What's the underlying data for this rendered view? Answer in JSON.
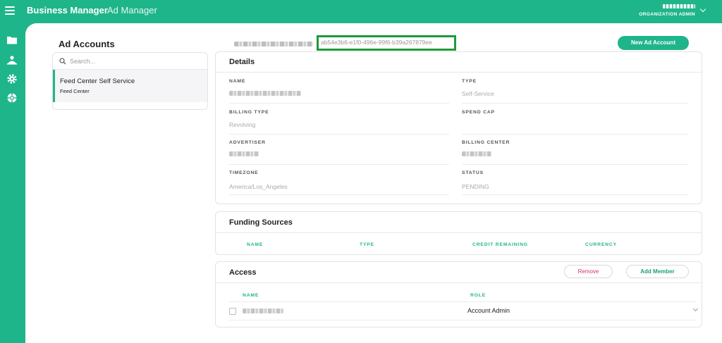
{
  "topbar": {
    "brand": "Business Manager",
    "nav_ad_manager": "Ad Manager",
    "user_role": "ORGANIZATION ADMIN"
  },
  "sidebar": {
    "icons": [
      "folder-icon",
      "members-icon",
      "gear-icon",
      "support-icon"
    ]
  },
  "accounts": {
    "title": "Ad Accounts",
    "search_placeholder": "Search...",
    "items": [
      {
        "name": "Feed Center Self Service",
        "sub": "Feed Center"
      }
    ]
  },
  "header": {
    "account_id": "ab54e3b6-e1f0-496e-99f6-b39a267879ee",
    "new_button": "New Ad Account"
  },
  "details": {
    "title": "Details",
    "name_label": "NAME",
    "type_label": "TYPE",
    "type_value": "Self-Service",
    "billing_type_label": "BILLING TYPE",
    "billing_type_value": "Revolving",
    "spend_cap_label": "SPEND CAP",
    "advertiser_label": "ADVERTISER",
    "billing_center_label": "BILLING CENTER",
    "timezone_label": "TIMEZONE",
    "timezone_value": "America/Los_Angeles",
    "status_label": "STATUS",
    "status_value": "PENDING"
  },
  "funding": {
    "title": "Funding Sources",
    "columns": [
      "NAME",
      "TYPE",
      "CREDIT REMAINING",
      "CURRENCY"
    ]
  },
  "access": {
    "title": "Access",
    "remove_button": "Remove",
    "add_button": "Add Member",
    "columns": [
      "NAME",
      "ROLE"
    ],
    "rows": [
      {
        "role": "Account Admin"
      }
    ]
  },
  "colors": {
    "brand_green": "#1fb58a",
    "id_highlight": "#1e9a3a",
    "remove_red": "#e0325d"
  }
}
